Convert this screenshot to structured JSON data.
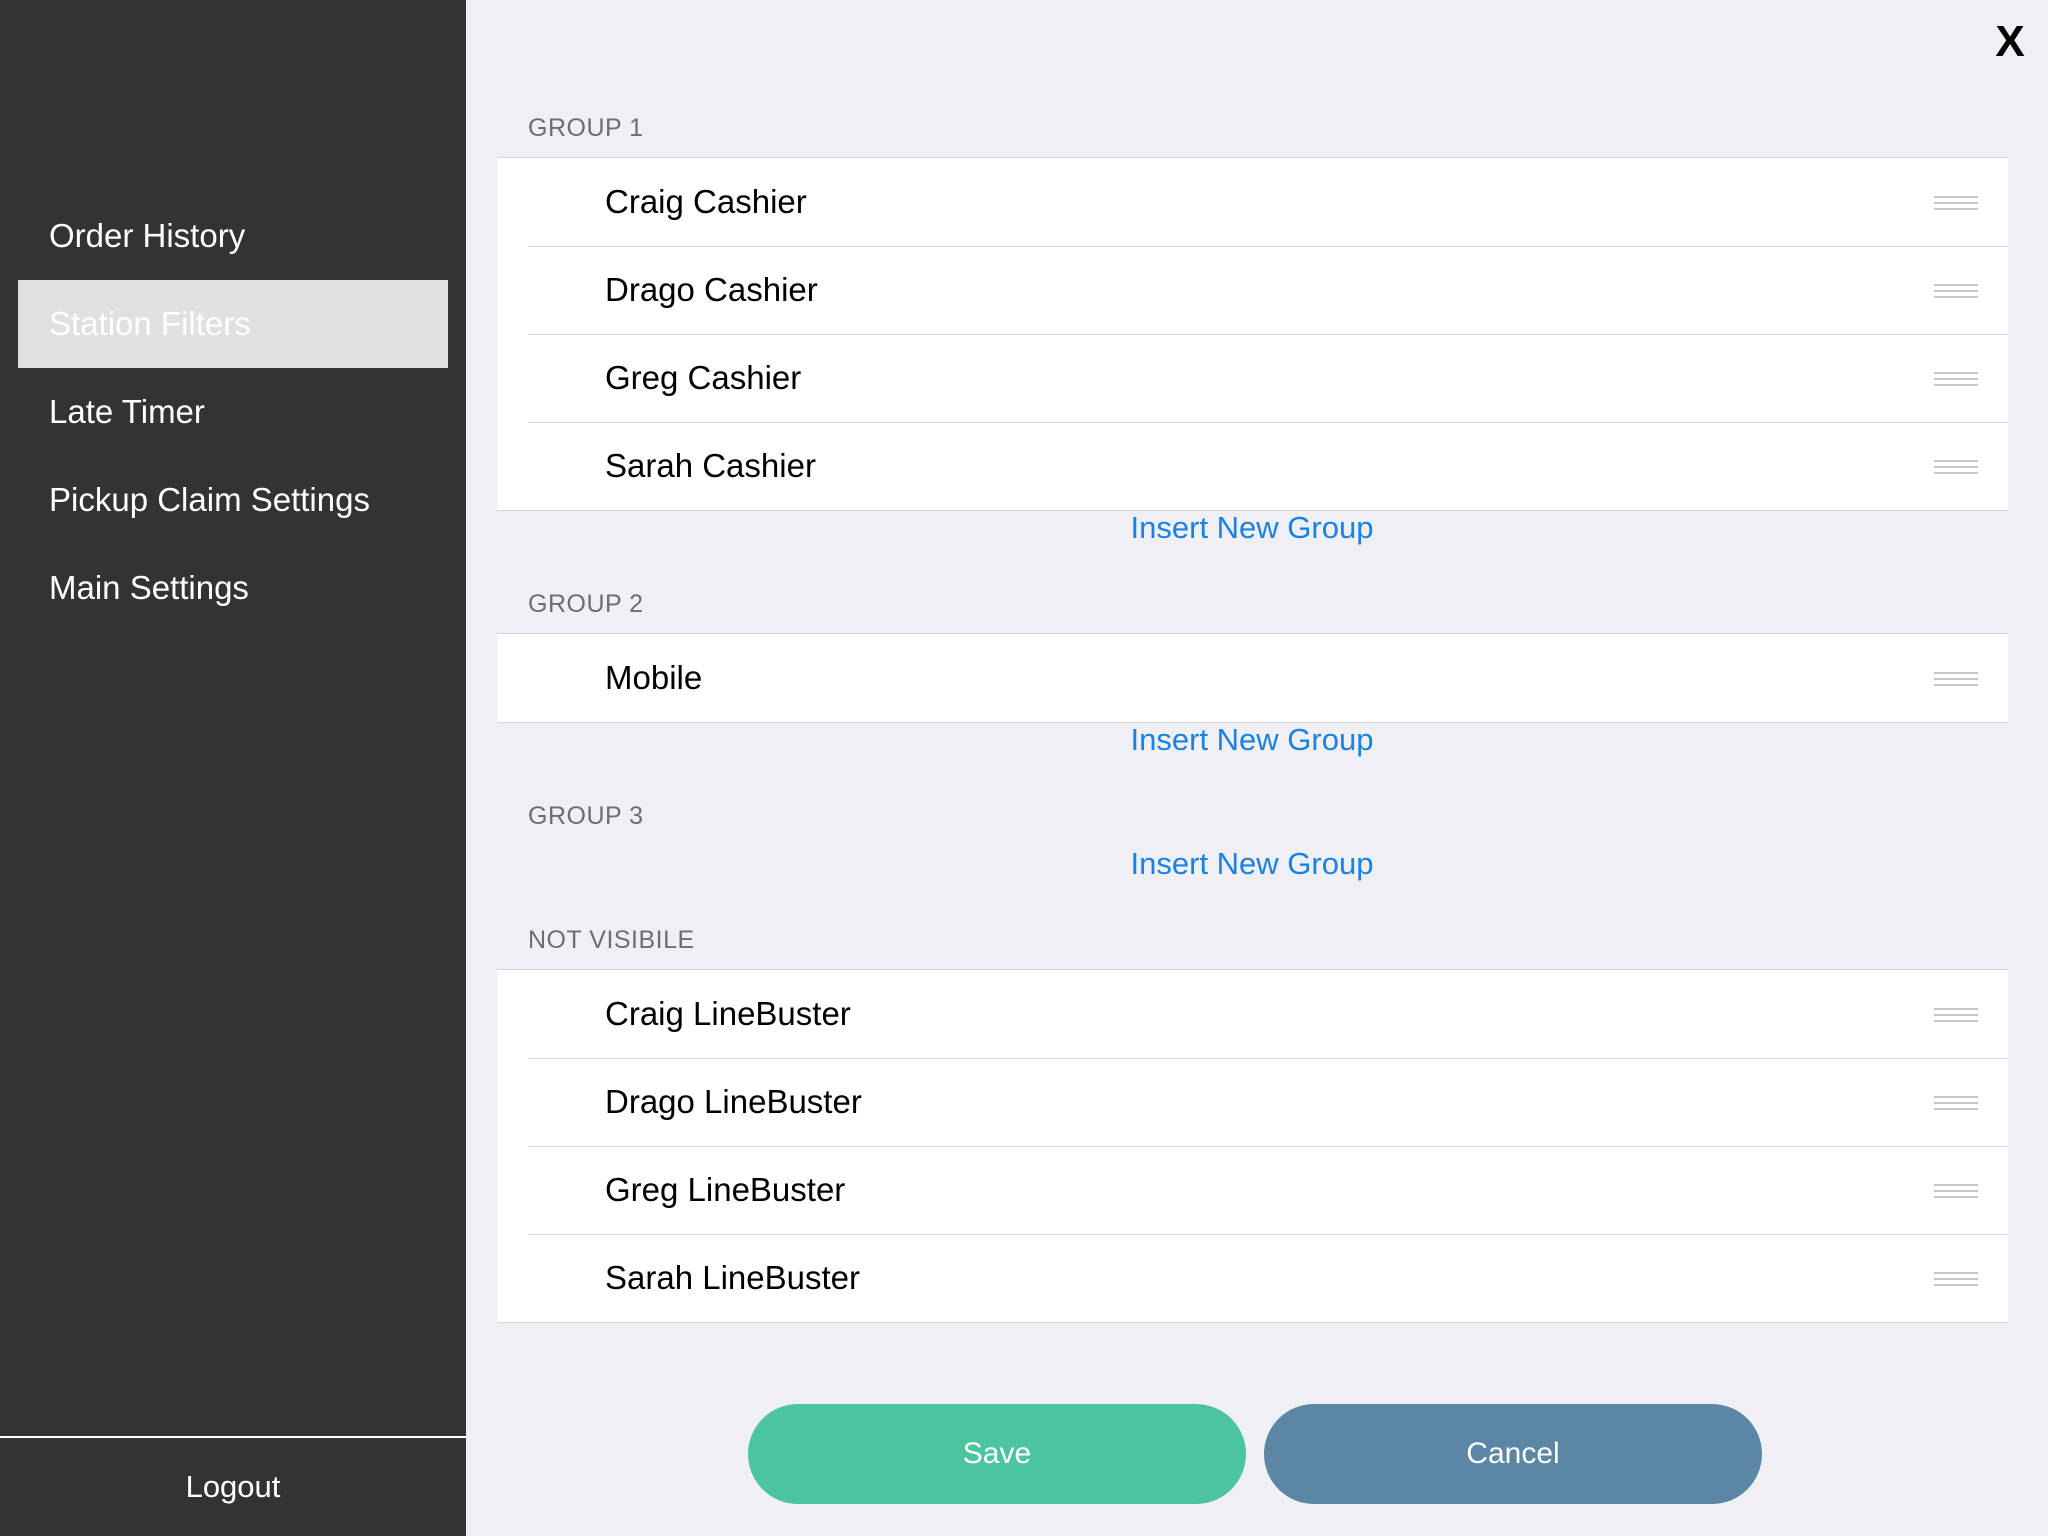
{
  "sidebar": {
    "items": [
      {
        "label": "Order History"
      },
      {
        "label": "Station Filters"
      },
      {
        "label": "Late Timer"
      },
      {
        "label": "Pickup Claim Settings"
      },
      {
        "label": "Main Settings"
      }
    ],
    "active_item": "Station Filters",
    "logout_label": "Logout"
  },
  "close_label": "X",
  "groups": [
    {
      "header": "GROUP 1",
      "rows": [
        "Craig Cashier",
        "Drago Cashier",
        "Greg Cashier",
        "Sarah Cashier"
      ],
      "insert_label": "Insert New Group"
    },
    {
      "header": "GROUP 2",
      "rows": [
        "Mobile"
      ],
      "insert_label": "Insert New Group"
    },
    {
      "header": "GROUP 3",
      "rows": [],
      "insert_label": "Insert New Group"
    },
    {
      "header": "NOT VISIBILE",
      "rows": [
        "Craig LineBuster",
        "Drago LineBuster",
        "Greg LineBuster",
        "Sarah LineBuster"
      ]
    }
  ],
  "buttons": {
    "save_label": "Save",
    "cancel_label": "Cancel"
  },
  "colors": {
    "sidebar_bg": "#333333",
    "active_bg": "#e0e0e0",
    "link": "#1a82e2",
    "save": "#4cc4a0",
    "cancel": "#5b87a4"
  }
}
